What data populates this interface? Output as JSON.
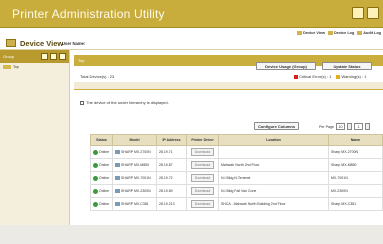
{
  "app": {
    "title": "Printer Administration Utility"
  },
  "toplinks": [
    "Device View",
    "Device Log",
    "Audit Log"
  ],
  "view": {
    "title": "Device View",
    "user_label": "User Name:"
  },
  "sidebar": {
    "header": "Group",
    "items": [
      {
        "label": "Top"
      }
    ]
  },
  "panel": {
    "group_label": "Top"
  },
  "buttons": {
    "usage": "Device Usage (Group)",
    "update": "Update Status",
    "configure": "Configure Columns"
  },
  "total": "Total Device(s) : 23",
  "status_counts": {
    "critical": "Critical Error(s) : 1",
    "warning": "Warning(s) : 1"
  },
  "notice": "The device of the under hierarchy is displayed.",
  "paging": {
    "per_page_label": "Per Page",
    "per_page_value": "10",
    "page_value": "1"
  },
  "table": {
    "columns": [
      "Status",
      "Model",
      "IP Address",
      "Printer Driver",
      "Location",
      "Name"
    ],
    "rows": [
      {
        "status": "Online",
        "model": "SHARP MX-2700N",
        "ip": "28.19.71",
        "driver": "Download",
        "location": "",
        "name": "Sharp MX-2700N"
      },
      {
        "status": "Online",
        "model": "SHARP MX-M850",
        "ip": "28.19.87",
        "driver": "Download",
        "location": "Mahwah North 2nd Floor",
        "name": "Sharp MX-M850"
      },
      {
        "status": "Online",
        "model": "SHARP MX-7001N",
        "ip": "28.19.72",
        "driver": "Download",
        "location": "N.I.Bldg.N.Tenenet",
        "name": "MX-7001N"
      },
      {
        "status": "Online",
        "model": "SHARP MX-2300N",
        "ip": "28.19.69",
        "driver": "Download",
        "location": "N.I.Bldg Fall Van Cone",
        "name": "MX-2300N"
      },
      {
        "status": "Online",
        "model": "SHARP MX-C381",
        "ip": "28.19.213",
        "driver": "Download",
        "location": "SHCA - Mahwah North Building 2nd Floor",
        "name": "Sharp MX-C381"
      }
    ]
  },
  "colors": {
    "titlebar": "#c8ac3c",
    "panel": "#c9ad3d",
    "online": "#3c9a3a",
    "critical": "#d42020",
    "warning": "#e0b020"
  }
}
